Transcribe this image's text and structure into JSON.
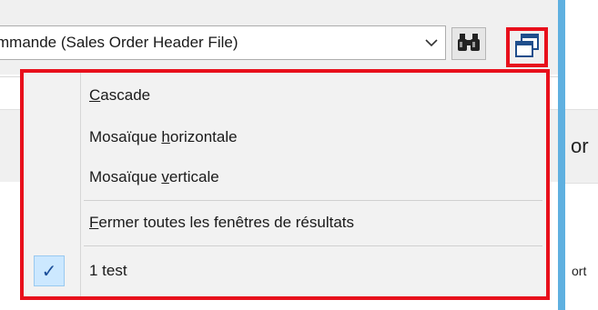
{
  "toolbar": {
    "table_select": {
      "value": "mmande (Sales Order Header File)",
      "arrow": "chevron-down-icon"
    },
    "find_button_icon": "binoculars-icon",
    "windows_button_icon": "cascade-windows-icon"
  },
  "menu": {
    "items": [
      {
        "before": "",
        "accel": "C",
        "after": "ascade"
      },
      {
        "before": "Mosaïque ",
        "accel": "h",
        "after": "orizontale"
      },
      {
        "before": "Mosaïque ",
        "accel": "v",
        "after": "erticale"
      },
      {
        "before": "",
        "accel": "F",
        "after": "ermer toutes les fenêtres de résultats"
      }
    ],
    "window_item": {
      "label": "1  test",
      "checked": true,
      "check_glyph": "✓"
    }
  },
  "side": {
    "header_text": "or",
    "row_text": "ort"
  },
  "colors": {
    "highlight": "#e8101c",
    "check_bg": "#cce8ff",
    "side_strip": "#5fb0e0"
  }
}
